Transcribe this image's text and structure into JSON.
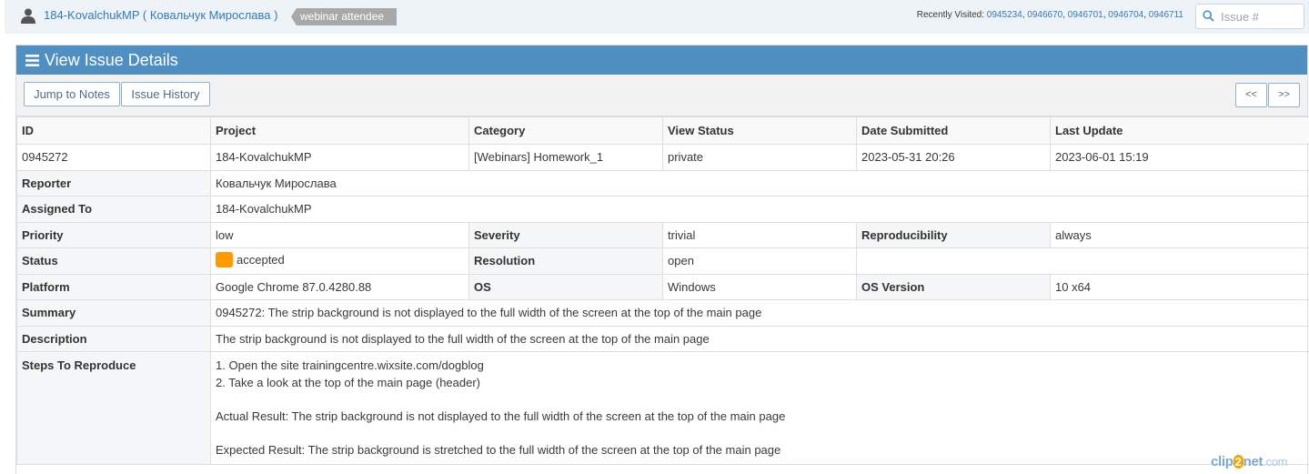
{
  "topbar": {
    "user_label": "184-KovalchukMP ( Ковальчук Мирослава )",
    "badge": "webinar attendee",
    "recent_prefix": "Recently Visited:",
    "recent": [
      "0945234",
      "0946670",
      "0946701",
      "0946704",
      "0946711"
    ],
    "search_placeholder": "Issue #"
  },
  "widget": {
    "title": "View Issue Details",
    "buttons": {
      "jump_to_notes": "Jump to Notes",
      "issue_history": "Issue History",
      "prev": "<<",
      "next": ">>"
    }
  },
  "table": {
    "headers": [
      "ID",
      "Project",
      "Category",
      "View Status",
      "Date Submitted",
      "Last Update"
    ],
    "summary_row": [
      "0945272",
      "184-KovalchukMP",
      "[Webinars] Homework_1",
      "private",
      "2023-05-31 20:26",
      "2023-06-01 15:19"
    ],
    "reporter": {
      "label": "Reporter",
      "value": "Ковальчук Мирослава"
    },
    "assigned_to": {
      "label": "Assigned To",
      "value": "184-KovalchukMP"
    },
    "priority": {
      "label": "Priority",
      "value": "low"
    },
    "severity": {
      "label": "Severity",
      "value": "trivial"
    },
    "reproducibility": {
      "label": "Reproducibility",
      "value": "always"
    },
    "status": {
      "label": "Status",
      "value": "accepted",
      "color": "#ff9900"
    },
    "resolution": {
      "label": "Resolution",
      "value": "open"
    },
    "platform": {
      "label": "Platform",
      "value": "Google Chrome 87.0.4280.88"
    },
    "os": {
      "label": "OS",
      "value": "Windows"
    },
    "os_version": {
      "label": "OS Version",
      "value": "10 x64"
    },
    "summary": {
      "label": "Summary",
      "value": "0945272: The strip background is not displayed to the full width of the screen at the top of the main page"
    },
    "description": {
      "label": "Description",
      "value": "The strip background is not displayed to the full width of the screen at the top of the main page"
    },
    "steps": {
      "label": "Steps To Reproduce",
      "lines": [
        "1. Open the site trainingcentre.wixsite.com/dogblog",
        "2. Take a look at the top of the main page (header)",
        "",
        "Actual Result: The strip background is not displayed to the full width of the screen at the top of the main page",
        "",
        "Expected Result: The strip background is stretched to the full width of the screen at the top of the main page"
      ]
    }
  },
  "watermark": {
    "part1": "clip",
    "part2": "2",
    "part3": "net",
    "part4": ".com"
  }
}
